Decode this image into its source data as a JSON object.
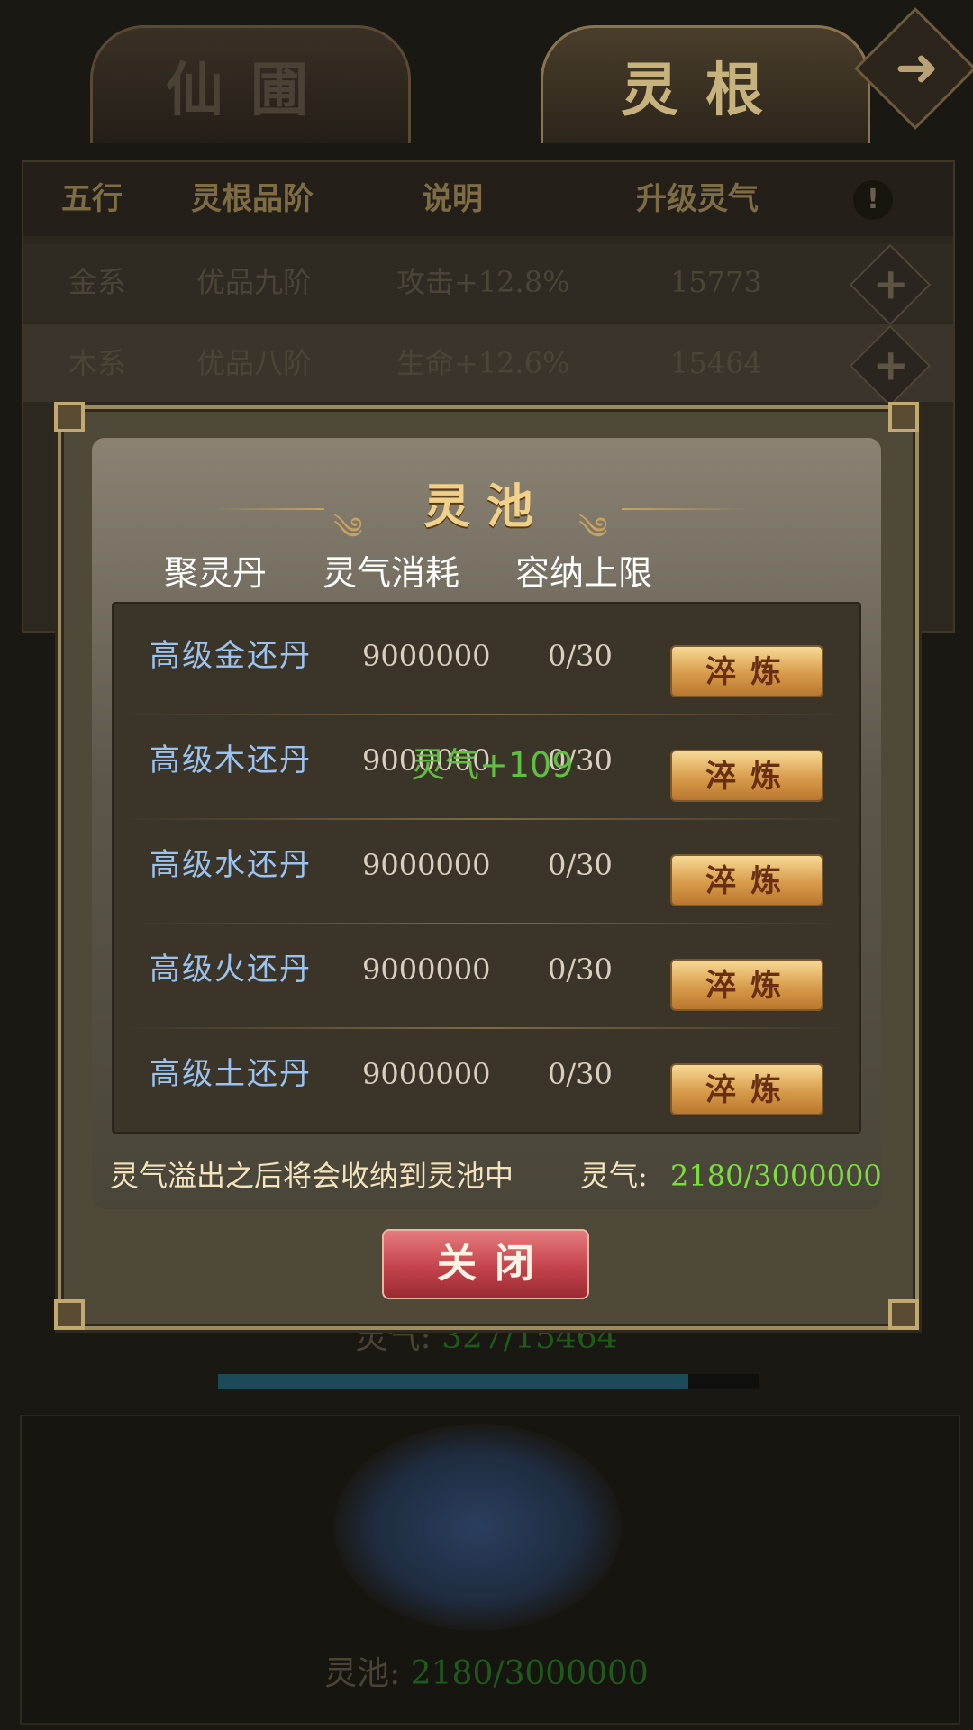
{
  "tabs": [
    {
      "label": "仙圃",
      "active": false
    },
    {
      "label": "灵根",
      "active": true
    }
  ],
  "table": {
    "headers": [
      "五行",
      "灵根品阶",
      "说明",
      "升级灵气"
    ],
    "info_icon": "!",
    "rows": [
      {
        "element": "金系",
        "grade": "优品九阶",
        "desc": "攻击+12.8%",
        "cost": "15773"
      },
      {
        "element": "木系",
        "grade": "优品八阶",
        "desc": "生命+12.6%",
        "cost": "15464"
      }
    ],
    "plus_icon": "+"
  },
  "background": {
    "lingqi_label": "灵气:",
    "lingqi_value": "327/15464",
    "progress": 0.87,
    "pool_label": "灵池:",
    "pool_value": "2180/3000000"
  },
  "modal": {
    "title": "灵池",
    "columns": [
      "聚灵丹",
      "灵气消耗",
      "容纳上限"
    ],
    "items": [
      {
        "name": "高级金还丹",
        "cost": "9000000",
        "cap": "0/30",
        "button": "淬炼"
      },
      {
        "name": "高级木还丹",
        "cost": "9000000",
        "cap": "0/30",
        "button": "淬炼"
      },
      {
        "name": "高级水还丹",
        "cost": "9000000",
        "cap": "0/30",
        "button": "淬炼"
      },
      {
        "name": "高级火还丹",
        "cost": "9000000",
        "cap": "0/30",
        "button": "淬炼"
      },
      {
        "name": "高级土还丹",
        "cost": "9000000",
        "cap": "0/30",
        "button": "淬炼"
      }
    ],
    "float_text": "灵气+109",
    "footer_note": "灵气溢出之后将会收纳到灵池中",
    "footer_label": "灵气:",
    "footer_value": "2180/3000000",
    "close_label": "关闭"
  },
  "colors": {
    "accent_gold": "#f1d08a",
    "item_name": "#9cc3ef",
    "lingqi_green": "#7adf3c",
    "close_red": "#c4434c"
  },
  "icons": [
    "next-arrow-icon",
    "info-icon",
    "plus-icon"
  ]
}
